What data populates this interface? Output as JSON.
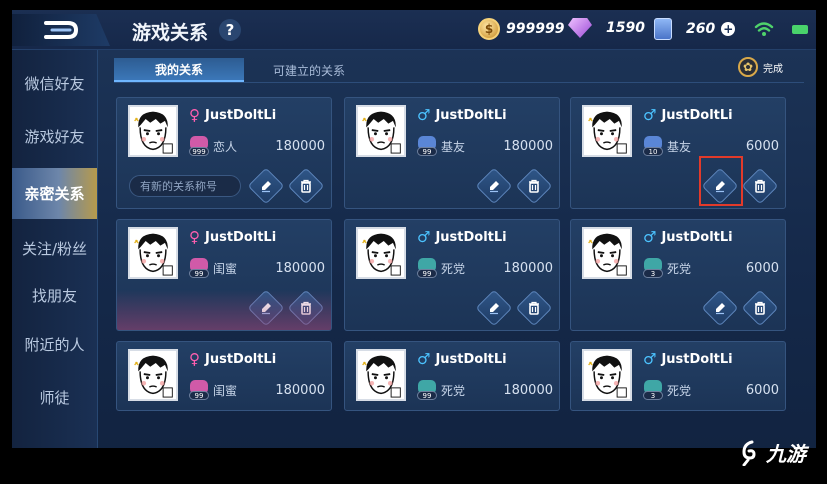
{
  "header": {
    "title": "游戏关系",
    "help": "?",
    "gold": "999999",
    "diamonds": "1590",
    "tickets": "260"
  },
  "sidebar": {
    "items": [
      {
        "label": "微信好友",
        "active": false
      },
      {
        "label": "游戏好友",
        "active": false
      },
      {
        "label": "亲密关系",
        "active": true
      },
      {
        "label": "关注/粉丝",
        "active": false
      },
      {
        "label": "找朋友",
        "active": false
      },
      {
        "label": "附近的人",
        "active": false
      },
      {
        "label": "师徒",
        "active": false
      }
    ]
  },
  "tabs": [
    {
      "label": "我的关系",
      "active": true
    },
    {
      "label": "可建立的关系",
      "active": false
    }
  ],
  "done_label": "完成",
  "cards": [
    {
      "name": "JustDoltLi",
      "gender": "♀",
      "relation": "恋人",
      "level": "999",
      "score": "180000",
      "placeholder": "有新的关系称号",
      "badge_color": "#d05aa8"
    },
    {
      "name": "JustDoltLi",
      "gender": "♂",
      "relation": "基友",
      "level": "99",
      "score": "180000",
      "badge_color": "#5a86d6"
    },
    {
      "name": "JustDoltLi",
      "gender": "♂",
      "relation": "基友",
      "level": "10",
      "score": "6000",
      "badge_color": "#5a86d6"
    },
    {
      "name": "JustDoltLi",
      "gender": "♀",
      "relation": "闺蜜",
      "level": "99",
      "score": "180000",
      "badge_color": "#d05aa8"
    },
    {
      "name": "JustDoltLi",
      "gender": "♂",
      "relation": "死党",
      "level": "99",
      "score": "180000",
      "badge_color": "#3fa7a6"
    },
    {
      "name": "JustDoltLi",
      "gender": "♂",
      "relation": "死党",
      "level": "3",
      "score": "6000",
      "badge_color": "#3fa7a6"
    },
    {
      "name": "JustDoltLi",
      "gender": "♀",
      "relation": "闺蜜",
      "level": "99",
      "score": "180000",
      "badge_color": "#d05aa8"
    },
    {
      "name": "JustDoltLi",
      "gender": "♂",
      "relation": "死党",
      "level": "99",
      "score": "180000",
      "badge_color": "#3fa7a6"
    },
    {
      "name": "JustDoltLi",
      "gender": "♂",
      "relation": "死党",
      "level": "3",
      "score": "6000",
      "badge_color": "#3fa7a6"
    }
  ],
  "watermark": "九游"
}
